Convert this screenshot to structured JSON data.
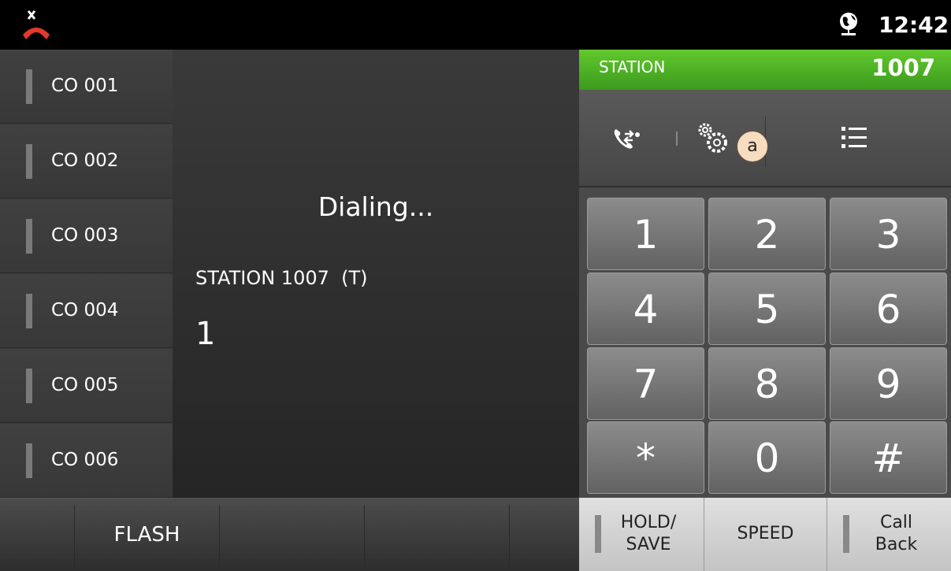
{
  "status_bar": {
    "time": "12:42",
    "icons": [
      "call-end-icon",
      "globe-icon"
    ]
  },
  "co_lines": [
    {
      "label": "CO 001"
    },
    {
      "label": "CO 002"
    },
    {
      "label": "CO 003"
    },
    {
      "label": "CO 004"
    },
    {
      "label": "CO 005"
    },
    {
      "label": "CO 006"
    }
  ],
  "call": {
    "status": "Dialing...",
    "station": "STATION 1007  (T)",
    "dialed": "1"
  },
  "station_header": {
    "label": "STATION",
    "number": "1007"
  },
  "toolbar": {
    "icons": [
      "call-transfer-icon",
      "gears-icon",
      "list-menu-icon"
    ],
    "badge": "a"
  },
  "keypad": [
    "1",
    "2",
    "3",
    "4",
    "5",
    "6",
    "7",
    "8",
    "9",
    "*",
    "0",
    "#"
  ],
  "bottom_bar": {
    "flash_label": "FLASH"
  },
  "function_keys": {
    "hold_save": {
      "line1": "HOLD/",
      "line2": "SAVE"
    },
    "speed": "SPEED",
    "call_back": {
      "line1": "Call",
      "line2": "Back"
    }
  },
  "colors": {
    "station_green": "#4cb524",
    "background": "#3a3a3a",
    "hangup_red": "#e03a2a"
  }
}
